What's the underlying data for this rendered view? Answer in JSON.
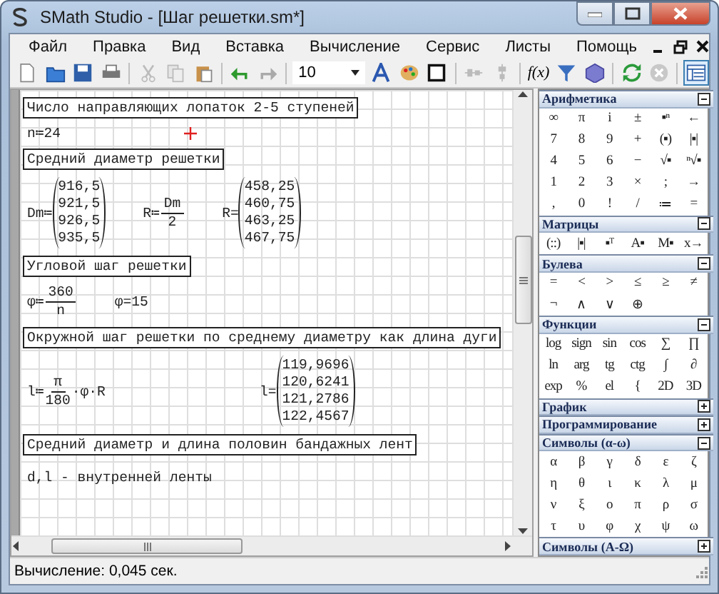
{
  "window": {
    "title": "SMath Studio - [Шаг решетки.sm*]"
  },
  "menu": [
    "Файл",
    "Правка",
    "Вид",
    "Вставка",
    "Вычисление",
    "Сервис",
    "Листы",
    "Помощь"
  ],
  "toolbar": {
    "font_size": "10",
    "function_button": "f(x)"
  },
  "worksheet": [
    {
      "kind": "heading",
      "text": "Число направляющих лопаток 2-5 ступеней"
    },
    {
      "kind": "math",
      "cursor": true,
      "exprs": [
        {
          "parts": [
            {
              "kind": "text",
              "text": "n≔24"
            }
          ]
        }
      ]
    },
    {
      "kind": "heading",
      "text": "Средний диаметр решетки"
    },
    {
      "kind": "math",
      "exprs": [
        {
          "parts": [
            {
              "kind": "text",
              "text": "Dm≔"
            },
            {
              "kind": "matrix",
              "cells": [
                "916,5",
                "921,5",
                "926,5",
                "935,5"
              ]
            }
          ]
        },
        {
          "parts": [
            {
              "kind": "text",
              "text": "R≔"
            },
            {
              "kind": "frac",
              "num": "Dm",
              "den": "2"
            }
          ]
        },
        {
          "parts": [
            {
              "kind": "text",
              "text": "R="
            },
            {
              "kind": "matrix",
              "cells": [
                "458,25",
                "460,75",
                "463,25",
                "467,75"
              ]
            }
          ]
        }
      ]
    },
    {
      "kind": "heading",
      "text": "Угловой шаг решетки"
    },
    {
      "kind": "math",
      "exprs": [
        {
          "parts": [
            {
              "kind": "text",
              "text": "φ≔"
            },
            {
              "kind": "frac",
              "num": "360",
              "den": "n"
            }
          ]
        },
        {
          "parts": [
            {
              "kind": "text",
              "text": "φ=15"
            }
          ]
        }
      ]
    },
    {
      "kind": "heading",
      "text": "Окружной шаг решетки по среднему диаметру как длина дуги"
    },
    {
      "kind": "math",
      "exprs": [
        {
          "parts": [
            {
              "kind": "text",
              "text": "l≔"
            },
            {
              "kind": "frac",
              "num": "π",
              "den": "180"
            },
            {
              "kind": "text",
              "text": "·φ·R"
            }
          ]
        },
        {
          "parts": [
            {
              "kind": "text",
              "text": "l="
            },
            {
              "kind": "matrix",
              "cells": [
                "119,9696",
                "120,6241",
                "121,2786",
                "122,4567"
              ]
            }
          ]
        }
      ]
    },
    {
      "kind": "heading",
      "text": "Средний диаметр и длина половин бандажных лент"
    },
    {
      "kind": "text",
      "text": "d,l - внутренней ленты"
    }
  ],
  "panels": [
    {
      "title": "Арифметика",
      "expanded": true,
      "buttons": [
        "∞",
        "π",
        "i",
        "±",
        "▪ⁿ",
        "←",
        "7",
        "8",
        "9",
        "+",
        "(▪)",
        "|▪|",
        "4",
        "5",
        "6",
        "−",
        "√▪",
        "ⁿ√▪",
        "1",
        "2",
        "3",
        "×",
        ";",
        "→",
        ",",
        "0",
        "!",
        "/",
        "≔",
        "="
      ]
    },
    {
      "title": "Матрицы",
      "expanded": true,
      "buttons": [
        "(::)",
        "|▪|",
        "▪ᵀ",
        "A▪",
        "M▪",
        "x→"
      ]
    },
    {
      "title": "Булева",
      "expanded": true,
      "buttons": [
        "=",
        "<",
        ">",
        "≤",
        "≥",
        "≠",
        "¬",
        "∧",
        "∨",
        "⊕"
      ]
    },
    {
      "title": "Функции",
      "expanded": true,
      "buttons": [
        "log",
        "sign",
        "sin",
        "cos",
        "∑",
        "∏",
        "ln",
        "arg",
        "tg",
        "ctg",
        "∫",
        "∂",
        "exp",
        "%",
        "el",
        "{",
        "2D",
        "3D"
      ]
    },
    {
      "title": "График",
      "expanded": false
    },
    {
      "title": "Программирование",
      "expanded": false
    },
    {
      "title": "Символы (α-ω)",
      "expanded": true,
      "buttons": [
        "α",
        "β",
        "γ",
        "δ",
        "ε",
        "ζ",
        "η",
        "θ",
        "ι",
        "κ",
        "λ",
        "μ",
        "ν",
        "ξ",
        "ο",
        "π",
        "ρ",
        "σ",
        "τ",
        "υ",
        "φ",
        "χ",
        "ψ",
        "ω"
      ]
    },
    {
      "title": "Символы (А-Ω)",
      "expanded": false
    }
  ],
  "status_bar": "Вычисление: 0,045 сек."
}
